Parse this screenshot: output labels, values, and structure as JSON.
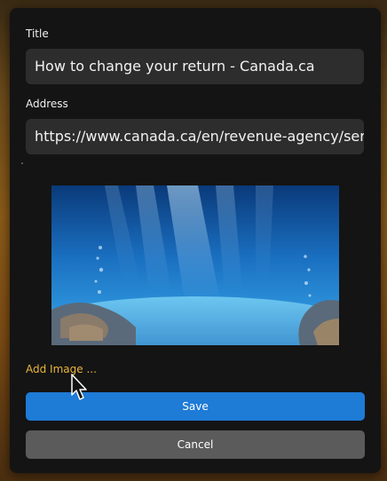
{
  "dialog": {
    "title_label": "Title",
    "title_value": "How to change your return - Canada.ca",
    "address_label": "Address",
    "address_value": "https://www.canada.ca/en/revenue-agency/services/tax/individuals/topics/about-your-tax-return",
    "add_image_label": "Add Image ...",
    "save_label": "Save",
    "cancel_label": "Cancel"
  },
  "colors": {
    "accent": "#1e7bd6",
    "link": "#e8b63a",
    "cancel": "#5b5b5b"
  },
  "preview": {
    "icon": "underwater-image"
  },
  "cursor": {
    "icon": "arrow-cursor-icon"
  }
}
